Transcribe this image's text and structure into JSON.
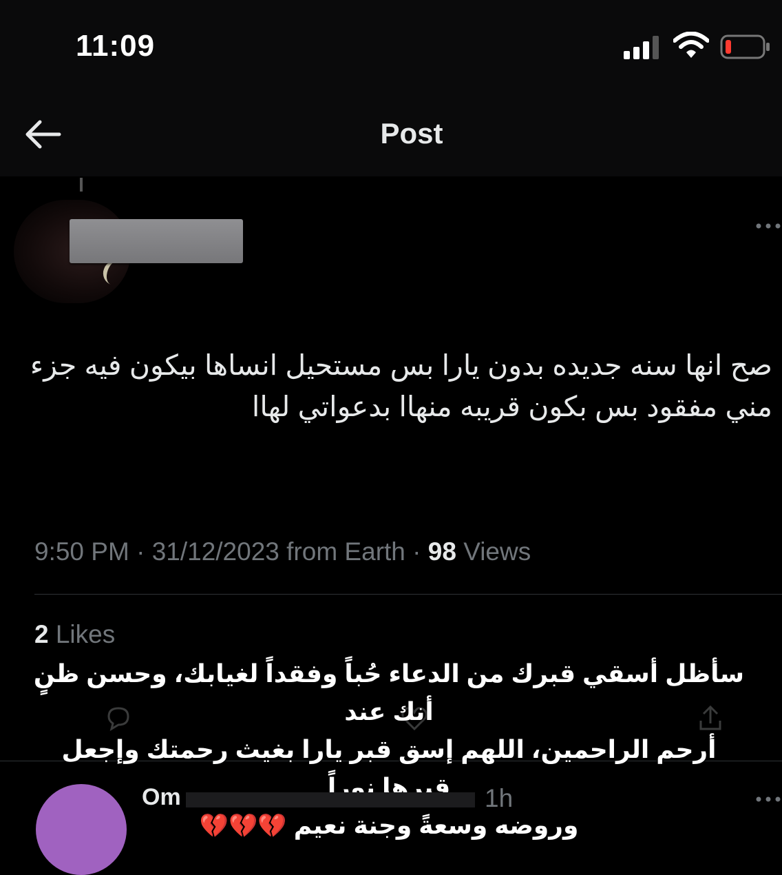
{
  "status_bar": {
    "time": "11:09",
    "icons": [
      "signal-icon",
      "wifi-icon",
      "battery-icon"
    ]
  },
  "nav": {
    "title": "Post",
    "back_icon": "arrow-left-icon"
  },
  "post": {
    "text": "صح انها سنه جديده بدون يارا بس مستحيل انساها بيكون فيه جزء مني مفقود بس بكون قريبه منهاا بدعواتي لهاا",
    "time": "9:50 PM",
    "date": "31/12/2023",
    "source": "from Earth",
    "views_count": "98",
    "views_label": "Views",
    "likes_count": "2",
    "likes_label": "Likes",
    "more_icon": "more-horizontal-icon"
  },
  "overlay_caption": {
    "line1": "سأظل أسقي قبرك من الدعاء حُباً وفقداً لغيابك، وحسن ظنٍ أنك عند",
    "line2": "أرحم الراحمين، اللهم إسق قبر يارا بغيث رحمتك وإجعل قبرها نوراً",
    "line3": "وروضه وسعةً وجنة نعيم",
    "hearts": "💔💔💔"
  },
  "reply": {
    "name_partial": "Om",
    "time": "1h",
    "avatar_color": "#a062c0"
  },
  "colors": {
    "background": "#000000",
    "text_primary": "#e7e9ea",
    "text_secondary": "#71767b",
    "divider": "#2f3336",
    "battery_low": "#ff3b30"
  }
}
